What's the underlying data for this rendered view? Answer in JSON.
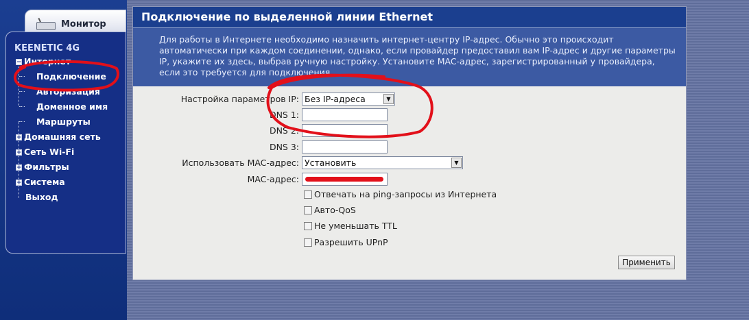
{
  "sidebar": {
    "monitor_tab": "Монитор",
    "device_name": "KEENETIC 4G",
    "items": [
      {
        "label": "Интернет",
        "expanded": true
      },
      {
        "label": "Подключение"
      },
      {
        "label": "Авторизация"
      },
      {
        "label": "Доменное имя"
      },
      {
        "label": "Маршруты"
      },
      {
        "label": "Домашняя сеть"
      },
      {
        "label": "Сеть Wi-Fi"
      },
      {
        "label": "Фильтры"
      },
      {
        "label": "Система"
      },
      {
        "label": "Выход"
      }
    ]
  },
  "main": {
    "title": "Подключение по выделенной линии Ethernet",
    "description": "Для работы в Интернете необходимо назначить интернет-центру IP-адрес. Обычно это происходит автоматически при каждом соединении, однако, если провайдер предоставил вам IP-адрес и другие параметры IP, укажите их здесь, выбрав ручную настройку. Установите MAC-адрес, зарегистрированный у провайдера, если это требуется для подключения.",
    "form": {
      "ip_settings_label": "Настройка параметров IP:",
      "ip_settings_value": "Без IP-адреса",
      "dns1_label": "DNS 1:",
      "dns1_value": "",
      "dns2_label": "DNS 2:",
      "dns2_value": "",
      "dns3_label": "DNS 3:",
      "dns3_value": "",
      "use_mac_label": "Использовать MAC-адрес:",
      "use_mac_value": "Установить",
      "mac_label": "MAC-адрес:"
    },
    "checkboxes": [
      {
        "label": "Отвечать на ping-запросы из Интернета",
        "checked": false
      },
      {
        "label": "Авто-QoS",
        "checked": false
      },
      {
        "label": "Не уменьшать TTL",
        "checked": false
      },
      {
        "label": "Разрешить UPnP",
        "checked": false
      }
    ],
    "apply_label": "Применить"
  },
  "icons": {
    "monitor": "router-icon",
    "expand": "plus-icon",
    "collapse": "minus-icon",
    "dropdown": "chevron-down-icon"
  },
  "colors": {
    "header_bg": "#1b3f8f",
    "desc_bg": "#3c5aa3",
    "sidebar_bg": "#152f86",
    "annotation": "#e2101a"
  }
}
